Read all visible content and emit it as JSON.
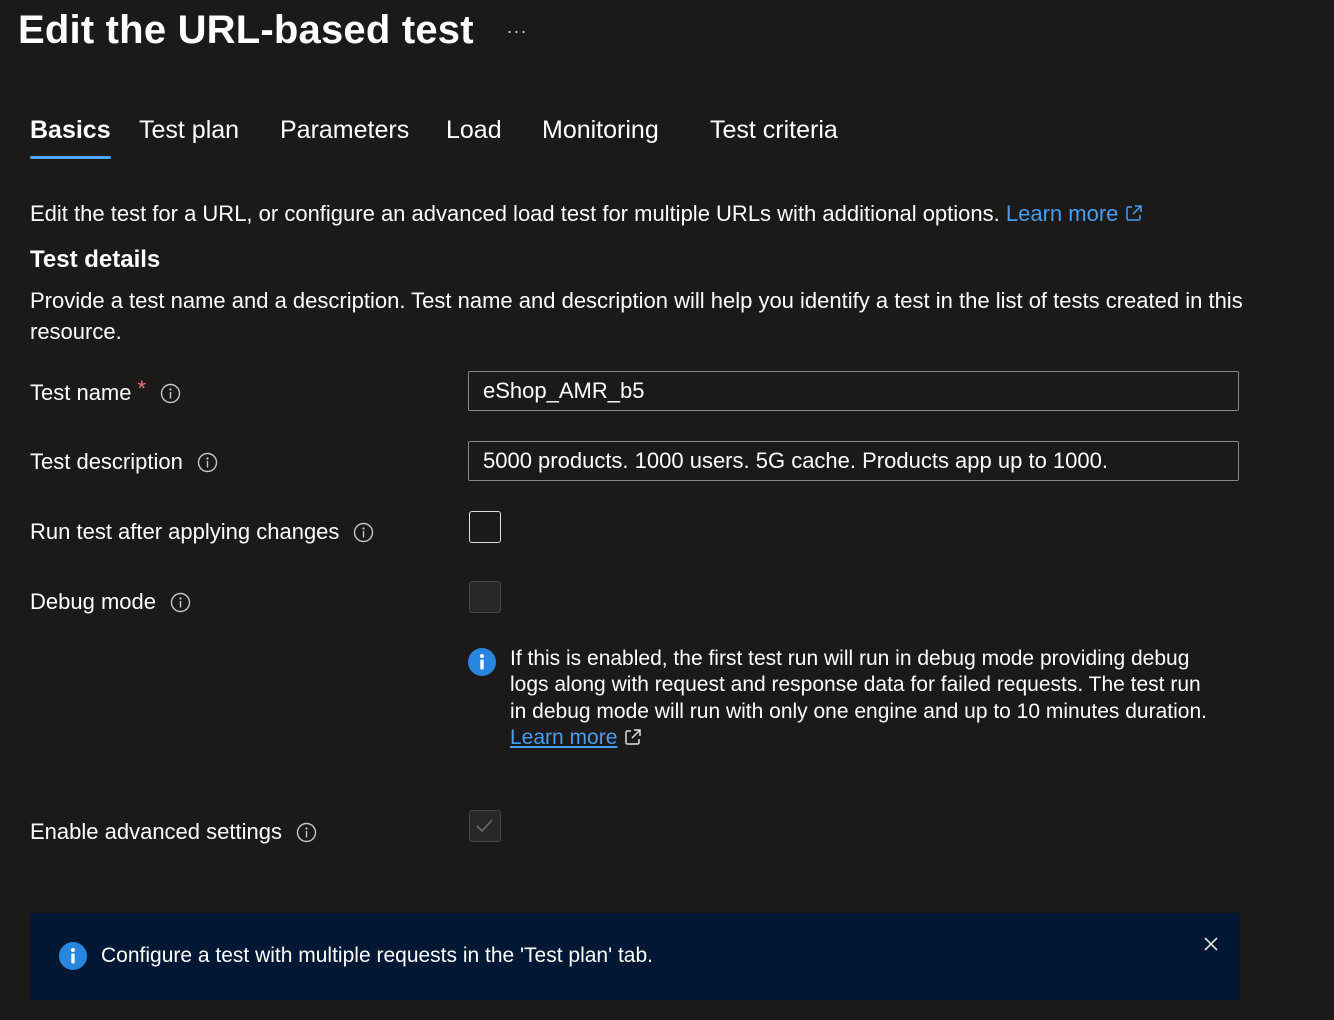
{
  "header": {
    "title": "Edit the URL-based test",
    "more_label": "···"
  },
  "tabs": [
    {
      "label": "Basics",
      "active": true
    },
    {
      "label": "Test plan"
    },
    {
      "label": "Parameters"
    },
    {
      "label": "Load"
    },
    {
      "label": "Monitoring"
    },
    {
      "label": "Test criteria"
    }
  ],
  "intro": {
    "text": "Edit the test for a URL, or configure an advanced load test for multiple URLs with additional options. ",
    "link": "Learn more"
  },
  "test_details": {
    "title": "Test details",
    "description": "Provide a test name and a description. Test name and description will help you identify a test in the list of tests created in this resource."
  },
  "form": {
    "test_name": {
      "label": "Test name",
      "required_mark": "*",
      "value": "eShop_AMR_b5"
    },
    "test_description": {
      "label": "Test description",
      "value": "5000 products. 1000 users. 5G cache. Products app up to 1000."
    },
    "run_after": {
      "label": "Run test after applying changes",
      "checked": false
    },
    "debug_mode": {
      "label": "Debug mode",
      "checked": false,
      "disabled": true
    },
    "debug_note": {
      "text": "If this is enabled, the first test run will run in debug mode providing debug logs along with request and response data for failed requests. The test run in debug mode will run with only one engine and up to 10 minutes duration. ",
      "link": "Learn more"
    },
    "advanced": {
      "label": "Enable advanced settings",
      "checked": true,
      "disabled": true
    }
  },
  "banner": {
    "text": "Configure a test with multiple requests in the 'Test plan' tab."
  },
  "colors": {
    "background": "#1b1a19",
    "accent": "#479ef5",
    "info_blue": "#2886de",
    "banner_bg": "#001833",
    "required": "#f1707b"
  }
}
